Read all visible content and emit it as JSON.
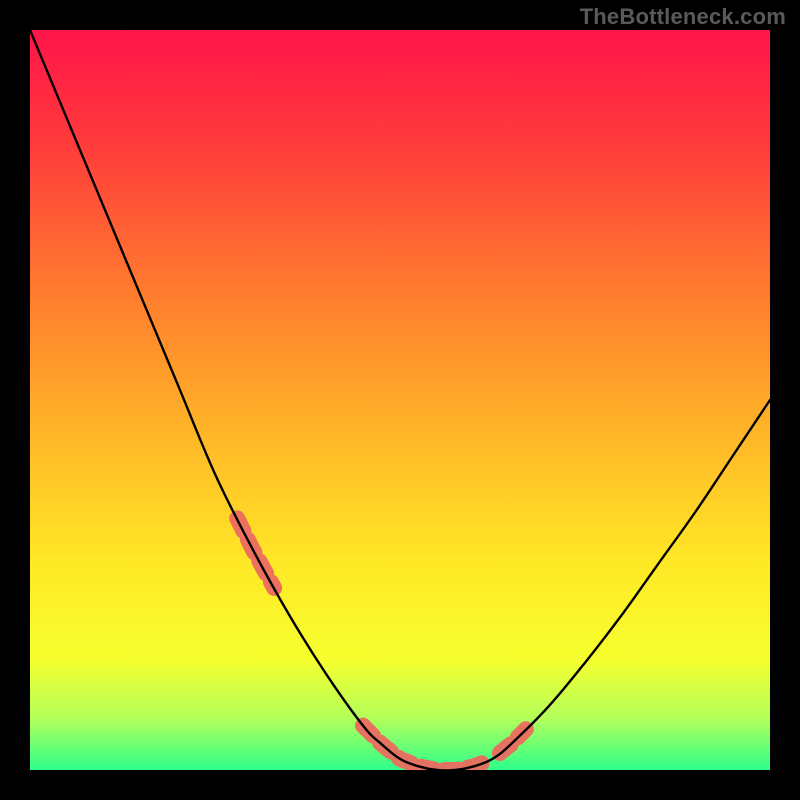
{
  "watermark": "TheBottleneck.com",
  "colors": {
    "frame": "#000000",
    "curve": "#000000",
    "highlight": "#ec6a5f",
    "gradient_stops": [
      {
        "offset": 0.0,
        "color": "#ff1449"
      },
      {
        "offset": 0.15,
        "color": "#ff3a3c"
      },
      {
        "offset": 0.35,
        "color": "#ff7a2e"
      },
      {
        "offset": 0.55,
        "color": "#ffb727"
      },
      {
        "offset": 0.72,
        "color": "#ffe826"
      },
      {
        "offset": 0.85,
        "color": "#f6ff2e"
      },
      {
        "offset": 0.93,
        "color": "#b3ff5a"
      },
      {
        "offset": 1.0,
        "color": "#2eff8a"
      }
    ]
  },
  "geometry": {
    "frame_inset": 30,
    "frame_stroke": 30
  },
  "chart_data": {
    "type": "line",
    "title": "",
    "xlabel": "",
    "ylabel": "",
    "x": [
      0.0,
      0.05,
      0.1,
      0.15,
      0.2,
      0.25,
      0.3,
      0.35,
      0.4,
      0.45,
      0.475,
      0.5,
      0.525,
      0.55,
      0.575,
      0.6,
      0.625,
      0.65,
      0.7,
      0.75,
      0.8,
      0.85,
      0.9,
      0.95,
      1.0
    ],
    "values": [
      1.0,
      0.88,
      0.76,
      0.64,
      0.52,
      0.4,
      0.3,
      0.21,
      0.13,
      0.06,
      0.035,
      0.015,
      0.005,
      0.0,
      0.0,
      0.005,
      0.015,
      0.035,
      0.085,
      0.145,
      0.21,
      0.28,
      0.35,
      0.425,
      0.5
    ],
    "xlim": [
      0,
      1
    ],
    "ylim": [
      0,
      1
    ],
    "grid": false,
    "legend": false,
    "highlight_segments": [
      {
        "x0": 0.28,
        "x1": 0.33
      },
      {
        "x0": 0.45,
        "x1": 0.62
      },
      {
        "x0": 0.635,
        "x1": 0.67
      }
    ]
  }
}
